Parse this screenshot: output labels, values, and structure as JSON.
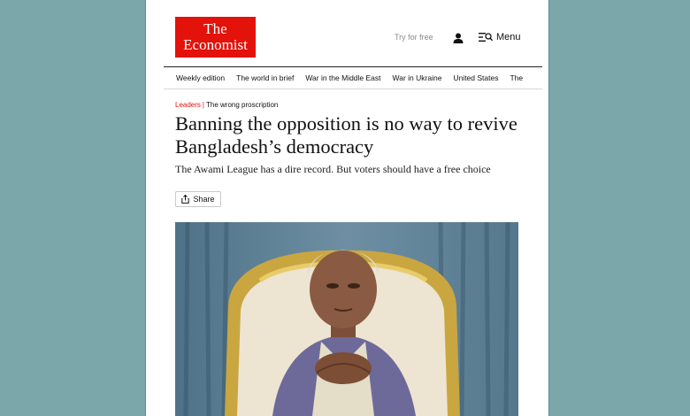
{
  "header": {
    "logo_line1": "The",
    "logo_line2": "Economist",
    "try_free": "Try for free",
    "menu_label": "Menu",
    "account_icon": "user-icon",
    "menu_icon": "menu-search-icon"
  },
  "nav": {
    "items": [
      "Weekly edition",
      "The world in brief",
      "War in the Middle East",
      "War in Ukraine",
      "United States",
      "The"
    ]
  },
  "article": {
    "section": "Leaders",
    "separator": "|",
    "flytitle": "The wrong proscription",
    "headline": "Banning the opposition is no way to revive Bangladesh’s democracy",
    "subhead": "The Awami League has a dire record. But voters should have a free choice",
    "share_label": "Share",
    "share_icon": "share-icon",
    "image_subject": "elderly-man-seated-in-gold-chair"
  },
  "colors": {
    "brand_red": "#e3120b",
    "background": "#7ba7ab",
    "page": "#ffffff"
  }
}
